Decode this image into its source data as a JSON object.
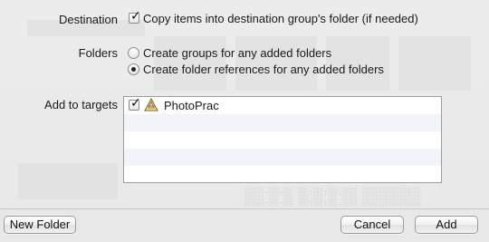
{
  "destination": {
    "label": "Destination",
    "copy_items_label": "Copy items into destination group's folder (if needed)",
    "copy_items_checked": true
  },
  "folders": {
    "label": "Folders",
    "options": [
      {
        "label": "Create groups for any added folders",
        "selected": false
      },
      {
        "label": "Create folder references for any added folders",
        "selected": true
      }
    ]
  },
  "targets": {
    "label": "Add to targets",
    "items": [
      {
        "name": "PhotoPrac",
        "checked": true,
        "icon": "app-target-icon"
      }
    ]
  },
  "buttons": {
    "new_folder": "New Folder",
    "cancel": "Cancel",
    "add": "Add"
  }
}
